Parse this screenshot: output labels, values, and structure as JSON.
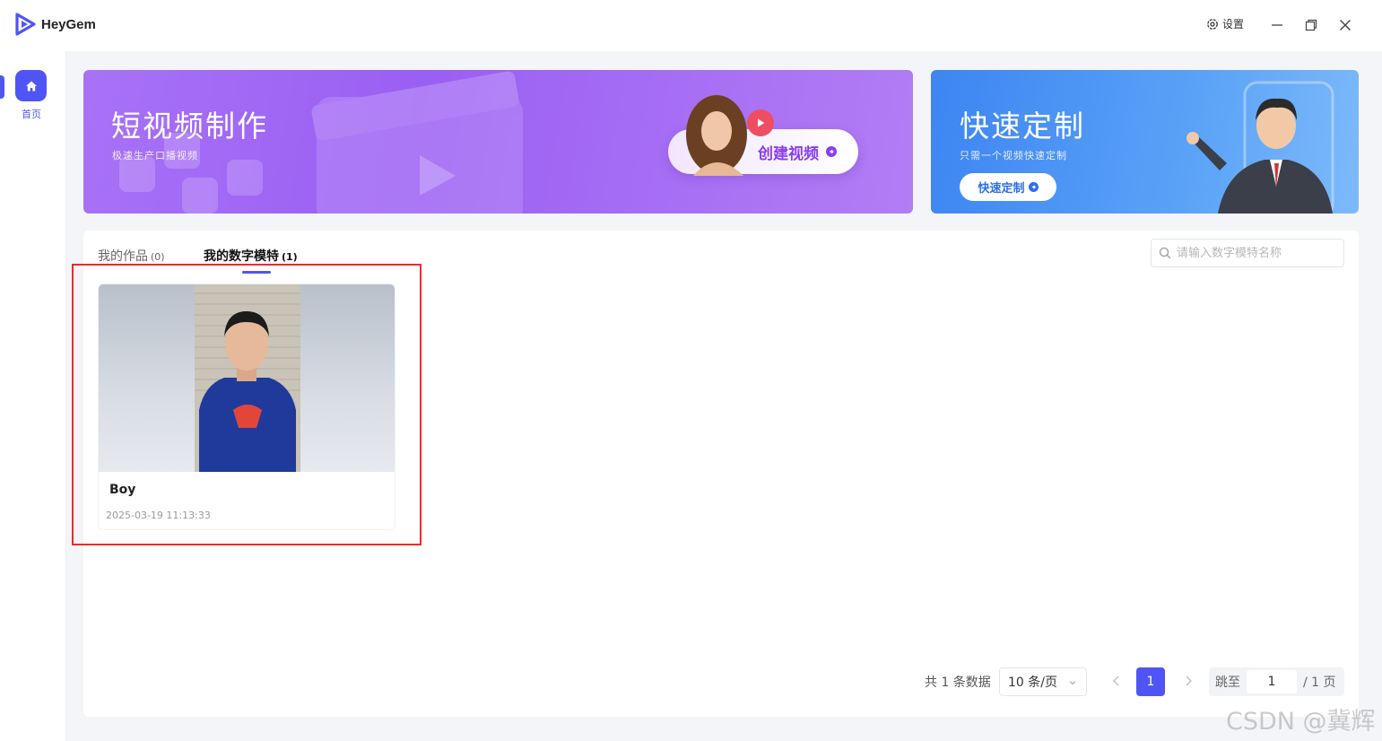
{
  "app": {
    "name": "HeyGem",
    "accent": "#4f55f5"
  },
  "window": {
    "settings_label": "设置"
  },
  "sidebar": {
    "items": [
      {
        "label": "首页",
        "icon": "home-icon",
        "active": true
      }
    ]
  },
  "banners": {
    "video": {
      "title": "短视频制作",
      "subtitle": "极速生产口播视频",
      "button": "创建视频",
      "color": "#9a5ff3"
    },
    "custom": {
      "title": "快速定制",
      "subtitle": "只需一个视频快速定制",
      "button": "快速定制",
      "color": "#3d85f2"
    }
  },
  "tabs": [
    {
      "label": "我的作品",
      "count": "(0)",
      "active": false
    },
    {
      "label": "我的数字模特",
      "count": "(1)",
      "active": true
    }
  ],
  "search": {
    "placeholder": "请输入数字模特名称",
    "value": ""
  },
  "models": [
    {
      "name": "Boy",
      "date": "2025-03-19 11:13:33"
    }
  ],
  "pagination": {
    "total": "共 1 条数据",
    "page_size": "10 条/页",
    "current_page": "1",
    "jump_label": "跳至",
    "jump_value": "1",
    "total_pages": "/ 1 页"
  },
  "watermark": "CSDN @冀辉"
}
